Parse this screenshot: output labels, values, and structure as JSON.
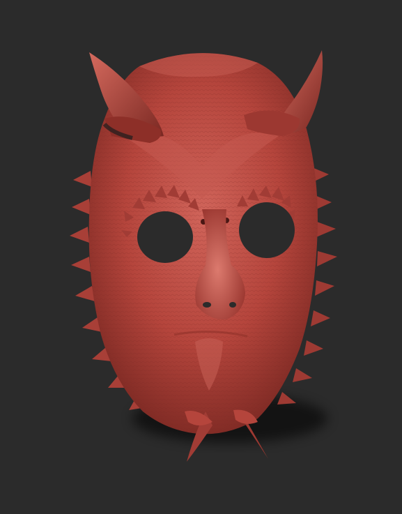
{
  "scene": {
    "background_color": "#2b2b2b",
    "subject": "sculpted-demon-mask",
    "material_color": "#b8463e",
    "material_highlight": "#d56a5e",
    "material_shadow": "#6e221d",
    "eye_hole_color": "#2b2b2b"
  }
}
